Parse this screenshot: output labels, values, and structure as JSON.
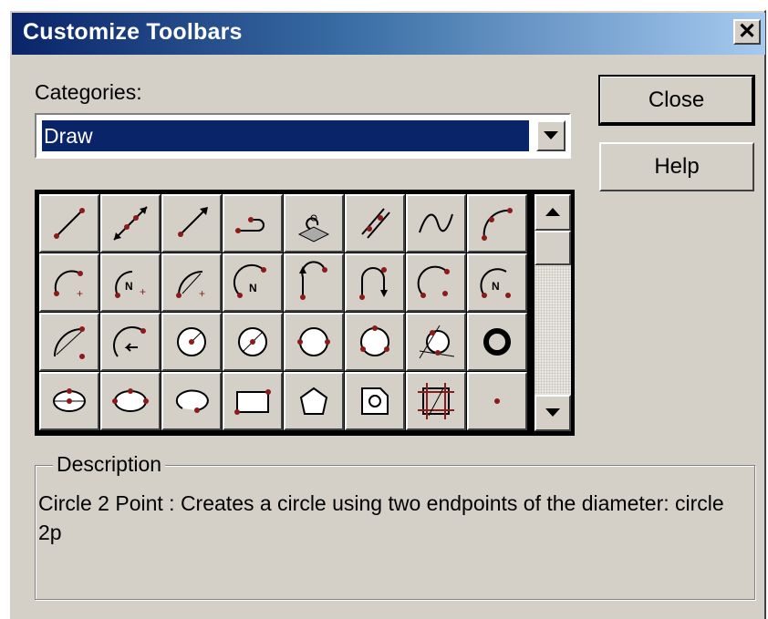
{
  "window": {
    "title": "Customize Toolbars",
    "close_glyph": "✕"
  },
  "categories": {
    "label": "Categories:",
    "selected": "Draw"
  },
  "buttons": {
    "close": "Close",
    "help": "Help"
  },
  "toolbar_grid": {
    "icons": [
      "line-icon",
      "xline-icon",
      "ray-icon",
      "polyline-icon",
      "3d-polyline-icon",
      "multiline-icon",
      "spline-icon",
      "arc-3point-icon",
      "arc-start-center-end-icon",
      "arc-start-center-angle-icon",
      "arc-start-center-length-icon",
      "arc-start-end-angle-icon",
      "arc-start-end-direction-icon",
      "arc-start-end-radius-icon",
      "arc-center-start-end-icon",
      "arc-center-start-angle-icon",
      "arc-center-start-length-icon",
      "arc-continue-icon",
      "circle-center-radius-icon",
      "circle-center-diameter-icon",
      "circle-2point-icon",
      "circle-3point-icon",
      "circle-tan-tan-radius-icon",
      "donut-icon",
      "ellipse-center-icon",
      "ellipse-axis-end-icon",
      "ellipse-arc-icon",
      "rectangle-icon",
      "polygon-icon",
      "region-icon",
      "boundary-icon",
      "point-icon"
    ]
  },
  "description": {
    "legend": "Description",
    "text": "Circle 2 Point : Creates a circle using two endpoints of the diameter:  circle 2p"
  }
}
